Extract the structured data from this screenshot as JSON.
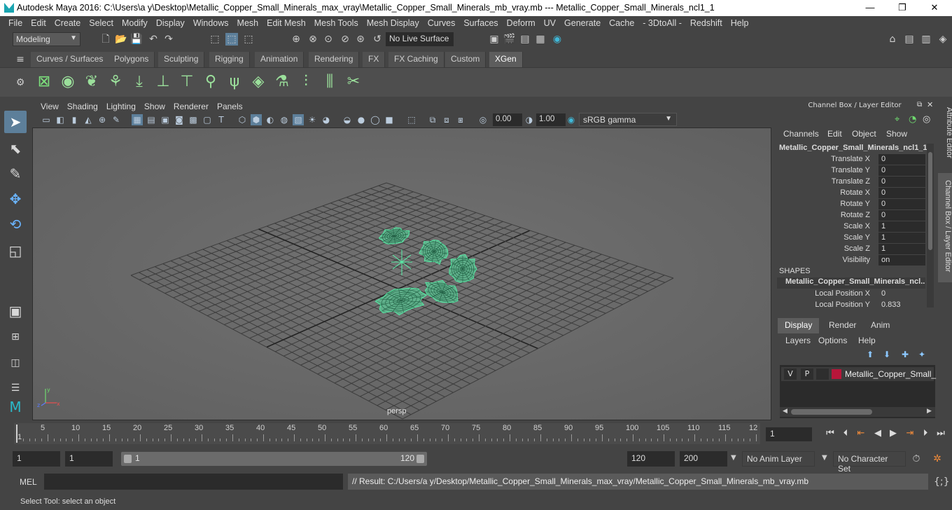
{
  "window": {
    "title": "Autodesk Maya 2016: C:\\Users\\a y\\Desktop\\Metallic_Copper_Small_Minerals_max_vray\\Metallic_Copper_Small_Minerals_mb_vray.mb   ---   Metallic_Copper_Small_Minerals_ncl1_1",
    "minimize": "—",
    "maximize": "❐",
    "close": "✕"
  },
  "menubar": [
    "File",
    "Edit",
    "Create",
    "Select",
    "Modify",
    "Display",
    "Windows",
    "Mesh",
    "Edit Mesh",
    "Mesh Tools",
    "Mesh Display",
    "Curves",
    "Surfaces",
    "Deform",
    "UV",
    "Generate",
    "Cache",
    "- 3DtoAll -",
    "Redshift",
    "Help"
  ],
  "toolbar": {
    "mode": "Modeling",
    "live_surface": "No Live Surface"
  },
  "shelf_tabs": [
    "Curves / Surfaces",
    "Polygons",
    "Sculpting",
    "Rigging",
    "Animation",
    "Rendering",
    "FX",
    "FX Caching",
    "Custom",
    "XGen"
  ],
  "active_shelf_tab": "XGen",
  "viewport": {
    "menu": [
      "View",
      "Shading",
      "Lighting",
      "Show",
      "Renderer",
      "Panels"
    ],
    "exposure": "0.00",
    "gamma_value": "1.00",
    "color_space": "sRGB gamma",
    "camera_label": "persp"
  },
  "channel_box": {
    "header": "Channel Box / Layer Editor",
    "menu": [
      "Channels",
      "Edit",
      "Object",
      "Show"
    ],
    "object_name": "Metallic_Copper_Small_Minerals_ncl1_1",
    "attributes": [
      {
        "label": "Translate X",
        "value": "0"
      },
      {
        "label": "Translate Y",
        "value": "0"
      },
      {
        "label": "Translate Z",
        "value": "0"
      },
      {
        "label": "Rotate X",
        "value": "0"
      },
      {
        "label": "Rotate Y",
        "value": "0"
      },
      {
        "label": "Rotate Z",
        "value": "0"
      },
      {
        "label": "Scale X",
        "value": "1"
      },
      {
        "label": "Scale Y",
        "value": "1"
      },
      {
        "label": "Scale Z",
        "value": "1"
      },
      {
        "label": "Visibility",
        "value": "on"
      }
    ],
    "shapes_heading": "SHAPES",
    "shape_name": "Metallic_Copper_Small_Minerals_ncl...",
    "shape_attributes": [
      {
        "label": "Local Position X",
        "value": "0"
      },
      {
        "label": "Local Position Y",
        "value": "0.833"
      }
    ],
    "side_tabs": [
      "Attribute Editor",
      "Channel Box / Layer Editor"
    ]
  },
  "layer_editor": {
    "tabs": [
      "Display",
      "Render",
      "Anim"
    ],
    "active_tab": "Display",
    "menu": [
      "Layers",
      "Options",
      "Help"
    ],
    "layer": {
      "v": "V",
      "p": "P",
      "name": "Metallic_Copper_Small_Minerals",
      "color": "#b8163a"
    }
  },
  "timeline": {
    "ticks": [
      "5",
      "10",
      "15",
      "20",
      "25",
      "30",
      "35",
      "40",
      "45",
      "50",
      "55",
      "60",
      "65",
      "70",
      "75",
      "80",
      "85",
      "90",
      "95",
      "100",
      "105",
      "110",
      "115",
      "12"
    ],
    "start_label": "1",
    "current_frame": "1"
  },
  "range": {
    "start": "1",
    "start_inner": "1",
    "slider_start": "1",
    "slider_end": "120",
    "end_inner": "120",
    "end": "200",
    "anim_layer": "No Anim Layer",
    "character_set": "No Character Set"
  },
  "command": {
    "label": "MEL",
    "result": "// Result: C:/Users/a y/Desktop/Metallic_Copper_Small_Minerals_max_vray/Metallic_Copper_Small_Minerals_mb_vray.mb"
  },
  "help_line": "Select Tool: select an object",
  "colors": {
    "mesh": "#55e8a4",
    "accent": "#5d7f9a",
    "layer": "#b8163a"
  }
}
